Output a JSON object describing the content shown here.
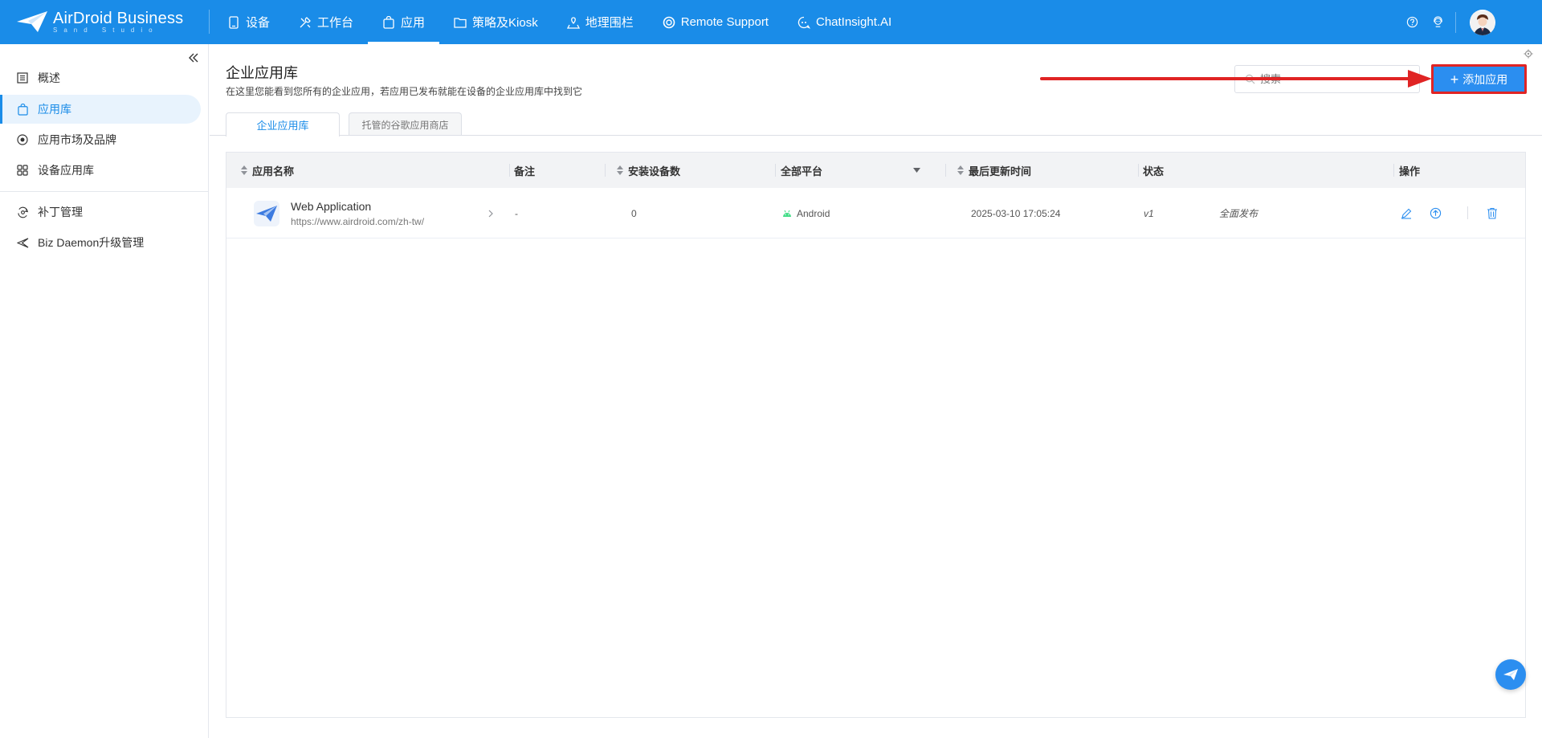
{
  "brand": {
    "name": "AirDroid Business",
    "subtitle": "Sand Studio"
  },
  "nav": {
    "items": [
      {
        "label": "设备",
        "icon": "phone-icon"
      },
      {
        "label": "工作台",
        "icon": "tools-icon"
      },
      {
        "label": "应用",
        "icon": "app-bag-icon",
        "active": true
      },
      {
        "label": "策略及Kiosk",
        "icon": "folder-icon"
      },
      {
        "label": "地理围栏",
        "icon": "map-pin-icon"
      },
      {
        "label": "Remote Support",
        "icon": "lifebuoy-icon"
      },
      {
        "label": "ChatInsight.AI",
        "icon": "chat-ai-icon"
      }
    ]
  },
  "sidebar": {
    "items": [
      {
        "label": "概述",
        "icon": "overview-icon"
      },
      {
        "label": "应用库",
        "icon": "app-bag-icon",
        "active": true
      },
      {
        "label": "应用市场及品牌",
        "icon": "store-icon"
      },
      {
        "label": "设备应用库",
        "icon": "grid-icon"
      },
      {
        "label": "补丁管理",
        "icon": "patch-icon"
      },
      {
        "label": "Biz Daemon升级管理",
        "icon": "paper-plane-icon"
      }
    ]
  },
  "page": {
    "title": "企业应用库",
    "description": "在这里您能看到您所有的企业应用，若应用已发布就能在设备的企业应用库中找到它",
    "search_placeholder": "搜索",
    "add_button": "添加应用"
  },
  "tabs": [
    {
      "label": "企业应用库",
      "active": true
    },
    {
      "label": "托管的谷歌应用商店",
      "active": false
    }
  ],
  "table": {
    "columns": [
      "应用名称",
      "备注",
      "安装设备数",
      "全部平台",
      "最后更新时间",
      "状态",
      "操作"
    ],
    "rows": [
      {
        "name": "Web Application",
        "url": "https://www.airdroid.com/zh-tw/",
        "note": "-",
        "installs": "0",
        "platform": "Android",
        "updated": "2025-03-10 17:05:24",
        "version": "v1",
        "status": "全面发布"
      }
    ]
  },
  "colors": {
    "primary": "#1a8ce8",
    "button": "#2b8ef0",
    "highlight": "#e02424",
    "android": "#3ddc84"
  }
}
